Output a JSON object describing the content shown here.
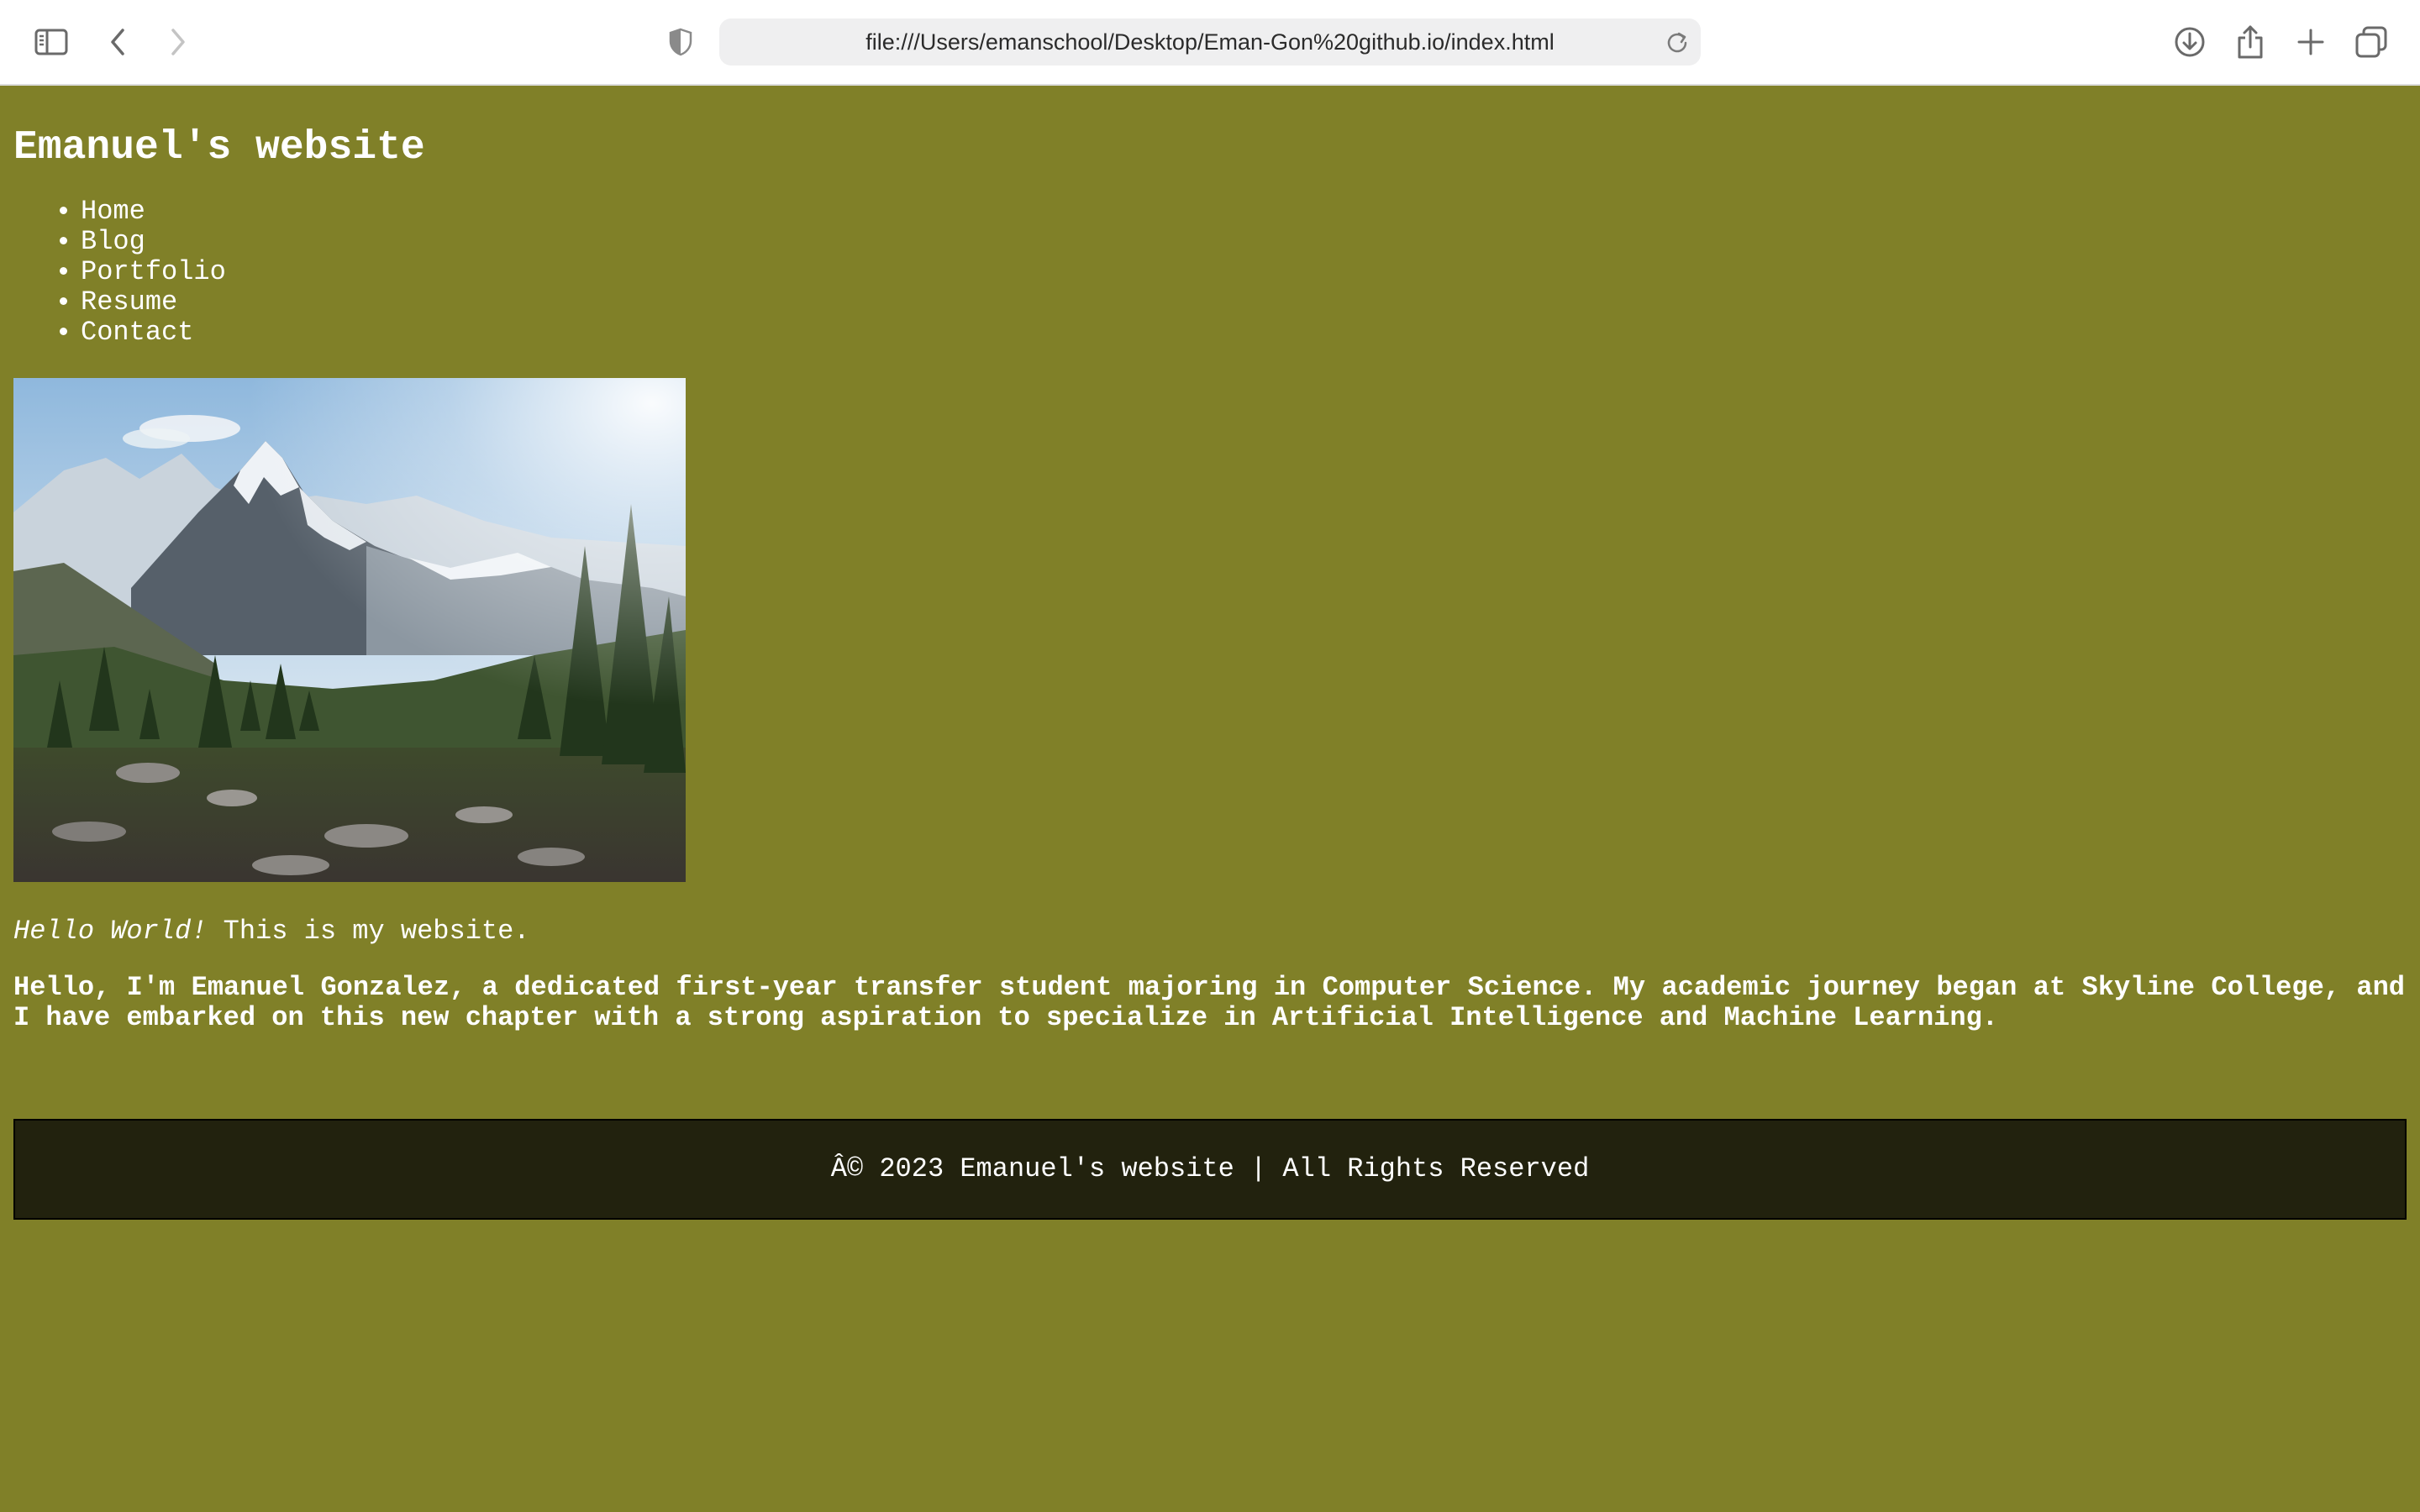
{
  "browser": {
    "url": "file:///Users/emanschool/Desktop/Eman-Gon%20github.io/index.html",
    "icons": {
      "sidebar": "sidebar-icon",
      "back": "chevron-left-icon",
      "forward": "chevron-right-icon",
      "privacy": "shield-icon",
      "reload": "reload-icon",
      "downloads": "download-icon",
      "share": "share-icon",
      "new_tab": "plus-icon",
      "tabs": "tab-overview-icon"
    }
  },
  "site": {
    "title": "Emanuel's website",
    "nav": [
      {
        "label": "Home"
      },
      {
        "label": "Blog"
      },
      {
        "label": "Portfolio"
      },
      {
        "label": "Resume"
      },
      {
        "label": "Contact"
      }
    ],
    "hero_image": {
      "subject": "mountain landscape photo"
    },
    "greeting_emphasis": "Hello World!",
    "greeting_rest": " This is my website.",
    "bio": "Hello, I'm Emanuel Gonzalez, a dedicated first-year transfer student majoring in Computer Science. My academic journey began at Skyline College, and I have embarked on this new chapter with a strong aspiration to specialize in Artificial Intelligence and Machine Learning.",
    "footer": "Â© 2023 Emanuel's website | All Rights Reserved"
  },
  "colors": {
    "page_background": "#808028",
    "text": "#ffffff",
    "footer_background": "#22220e"
  }
}
